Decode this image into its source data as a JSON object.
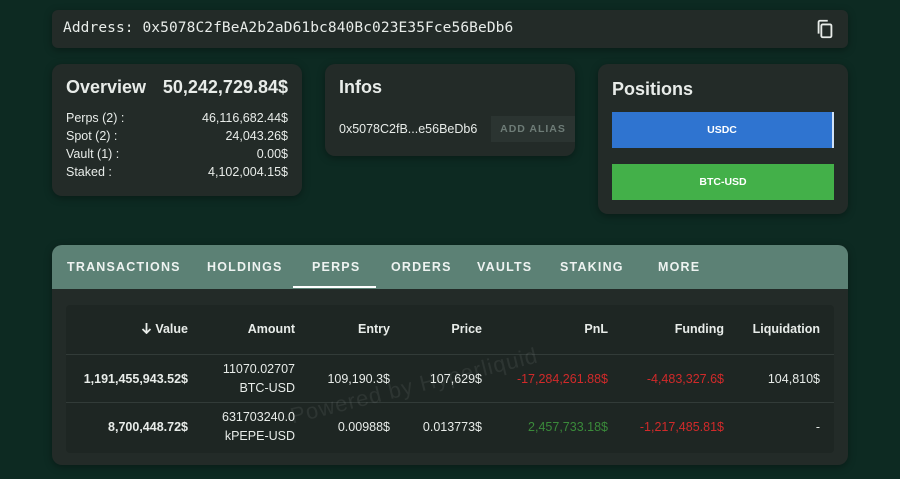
{
  "address_bar": {
    "text": "Address: 0x5078C2fBeA2b2aD61bc840Bc023E35Fce56BeDb6",
    "copy_icon": "copy-icon"
  },
  "overview": {
    "title": "Overview",
    "total": "50,242,729.84$",
    "rows": [
      {
        "label": "Perps (2) :",
        "value": "46,116,682.44$"
      },
      {
        "label": "Spot (2) :",
        "value": "24,043.26$"
      },
      {
        "label": "Vault (1) :",
        "value": "0.00$"
      },
      {
        "label": "Staked :",
        "value": "4,102,004.15$"
      }
    ]
  },
  "infos": {
    "title": "Infos",
    "short_address": "0x5078C2fB...e56BeDb6",
    "alias_button": "ADD ALIAS"
  },
  "positions": {
    "title": "Positions",
    "items": [
      "USDC",
      "BTC-USD"
    ],
    "colors": {
      "usdc": "#2f74d0",
      "btc": "#43b049"
    }
  },
  "tabs": [
    "TRANSACTIONS",
    "HOLDINGS",
    "PERPS",
    "ORDERS",
    "VAULTS",
    "STAKING",
    "MORE"
  ],
  "active_tab": "PERPS",
  "table": {
    "headers": [
      "Value",
      "Amount",
      "Entry",
      "Price",
      "PnL",
      "Funding",
      "Liquidation"
    ],
    "sort_icon": "arrow-down-icon",
    "rows": [
      {
        "value": "1,191,455,943.52$",
        "amount": "11070.02707",
        "asset": "BTC-USD",
        "entry": "109,190.3$",
        "price": "107,629$",
        "pnl": "-17,284,261.88$",
        "funding": "-4,483,327.6$",
        "liquidation": "104,810$"
      },
      {
        "value": "8,700,448.72$",
        "amount": "631703240.0",
        "asset": "kPEPE-USD",
        "entry": "0.00988$",
        "price": "0.013773$",
        "pnl": "2,457,733.18$",
        "funding": "-1,217,485.81$",
        "liquidation": "-"
      }
    ]
  },
  "watermark": "Powered by Hyperliquid",
  "theme": {
    "background": "#0d2a22",
    "card": "#232b28",
    "tabbar": "#5c8175",
    "negative": "#d12a2a",
    "positive": "#3a8a3a"
  }
}
